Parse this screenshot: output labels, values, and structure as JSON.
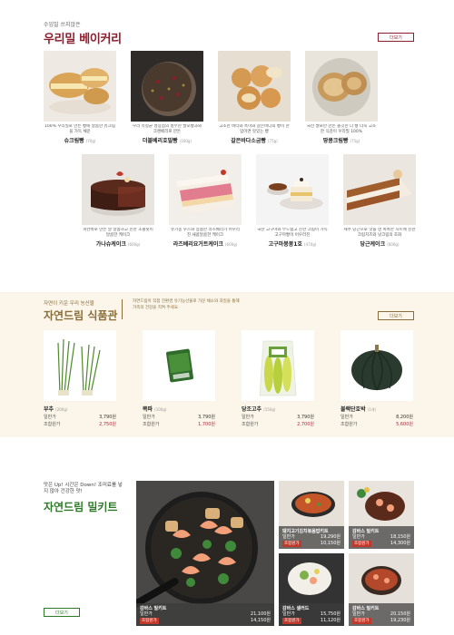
{
  "bakery": {
    "eyebrow": "수입밀 쓰지않은",
    "title": "우리밀 베이커리",
    "more_label": "더보기",
    "products": [
      {
        "desc": "100% 우리밀로 만든 빵에 달콤한 슈크림을 가득 채운",
        "name": "슈크림빵",
        "weight": "(70g)"
      },
      {
        "desc": "우리 유정균 성장점의 풍부한 발포빵과와 크랜베리로 만든",
        "name": "더블베리호밀빵",
        "weight": "(160g)"
      },
      {
        "desc": "고소한 버터와 흑미와 갈은바다의 빵이 한입이면 맛있는 빵",
        "name": "갈은바다소금빵",
        "weight": "(75g)"
      },
      {
        "desc": "국산 쌀로만 만든 쫄깃한 다 빵 더욱 고소한 식감이 우리밀 100%",
        "name": "땅콩크림빵",
        "weight": "(75g)"
      },
      {
        "desc": "피칸바로 만든 달 달콤하고 진한 초콜릿이 달콤한 케이크",
        "name": "가나슈케이크",
        "weight": "(600g)"
      },
      {
        "desc": "유기농 우스와 상큼한 라즈베리가 어우러진 새콤달콤한 케이크",
        "name": "라즈베리요거트케이크",
        "weight": "(600g)"
      },
      {
        "desc": "국산 고구마와 부드럽고 진한 크림이 가득 고구마빵이 어우러진",
        "name": "고구마봉봉1호",
        "weight": "(470g)"
      },
      {
        "desc": "제주 당근으로 맛을 낸 촉촉한 시트에 진한 크림치즈와 넛크림의 조화",
        "name": "당근케이크",
        "weight": "(600g)"
      }
    ]
  },
  "nature": {
    "eyebrow": "자연이 키운 우리 농산물",
    "title": "자연드림 식품관",
    "desc": "자연드림이 직접 친환경 유기농산물로 가꾼 채소와 과일을 통해 가족의 건강을 지켜 주세요.",
    "more_label": "더보기",
    "price_label": "일반가",
    "member_label": "조합원가",
    "items": [
      {
        "name": "부추",
        "weight": "(200g)",
        "price": "3,790원",
        "member": "2,750원"
      },
      {
        "name": "쪽파",
        "weight": "(100g)",
        "price": "3,790원",
        "member": "1,700원"
      },
      {
        "name": "당조고추",
        "weight": "(150g)",
        "price": "3,790원",
        "member": "2,700원"
      },
      {
        "name": "블랙단호박",
        "weight": "(1개)",
        "price": "8,200원",
        "member": "5,600원"
      }
    ]
  },
  "mealkit": {
    "eyebrow": "맛은 Up! 시간은 Down! 조미료를 넣지 않아 건강한 맛!",
    "title": "자연드림 밀키트",
    "more_label": "더보기",
    "price_label": "일반가",
    "member_label": "조합원가",
    "kits": [
      {
        "name": "감바스 밀키트",
        "price": "21,100원",
        "member": "14,150원"
      },
      {
        "name": "돼지고기김치볶음밥키트",
        "price": "19,290원",
        "member": "10,150원"
      },
      {
        "name": "감바스 밀키트",
        "price": "18,150원",
        "member": "14,300원"
      },
      {
        "name": "감바스 샐러드",
        "price": "15,750원",
        "member": "11,120원"
      },
      {
        "name": "감바스 밀키트",
        "price": "20,150원",
        "member": "19,230원"
      }
    ]
  }
}
